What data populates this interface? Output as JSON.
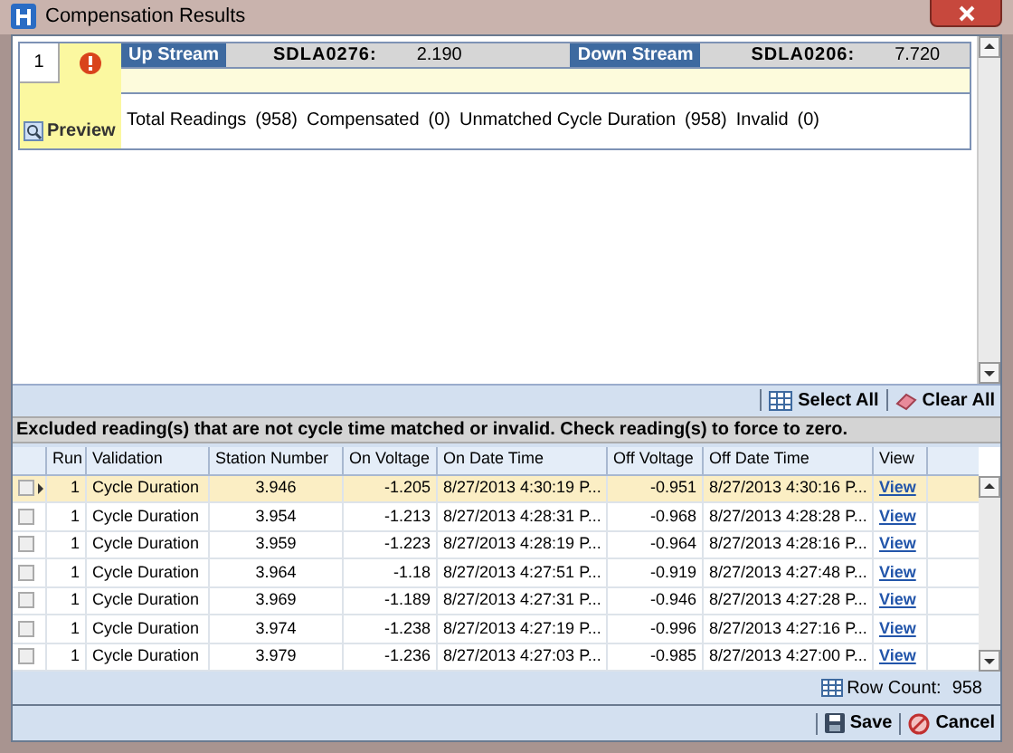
{
  "window": {
    "title": "Compensation Results"
  },
  "result_card": {
    "index": "1",
    "preview_label": "Preview",
    "upstream": {
      "label": "Up Stream",
      "station": "SDLA0276:",
      "value": "2.190"
    },
    "downstream": {
      "label": "Down Stream",
      "station": "SDLA0206:",
      "value": "7.720"
    },
    "summary": [
      {
        "label": "Total Readings",
        "count": "(958)"
      },
      {
        "label": "Compensated",
        "count": "(0)"
      },
      {
        "label": "Unmatched Cycle Duration",
        "count": "(958)"
      },
      {
        "label": "Invalid",
        "count": "(0)"
      }
    ]
  },
  "toolbar": {
    "select_all": "Select All",
    "clear_all": "Clear All"
  },
  "message": "Excluded reading(s) that are not cycle time matched or invalid. Check reading(s) to force to zero.",
  "table": {
    "columns": [
      "Run",
      "Validation",
      "Station Number",
      "On Voltage",
      "On Date Time",
      "Off Voltage",
      "Off Date Time",
      "View"
    ],
    "rows": [
      {
        "selected": true,
        "checked": false,
        "cells": [
          "1",
          "Cycle Duration",
          "3.946",
          "-1.205",
          "8/27/2013 4:30:19 P...",
          "-0.951",
          "8/27/2013 4:30:16 P...",
          "View"
        ]
      },
      {
        "selected": false,
        "checked": false,
        "cells": [
          "1",
          "Cycle Duration",
          "3.954",
          "-1.213",
          "8/27/2013 4:28:31 P...",
          "-0.968",
          "8/27/2013 4:28:28 P...",
          "View"
        ]
      },
      {
        "selected": false,
        "checked": false,
        "cells": [
          "1",
          "Cycle Duration",
          "3.959",
          "-1.223",
          "8/27/2013 4:28:19 P...",
          "-0.964",
          "8/27/2013 4:28:16 P...",
          "View"
        ]
      },
      {
        "selected": false,
        "checked": false,
        "cells": [
          "1",
          "Cycle Duration",
          "3.964",
          "-1.18",
          "8/27/2013 4:27:51 P...",
          "-0.919",
          "8/27/2013 4:27:48 P...",
          "View"
        ]
      },
      {
        "selected": false,
        "checked": false,
        "cells": [
          "1",
          "Cycle Duration",
          "3.969",
          "-1.189",
          "8/27/2013 4:27:31 P...",
          "-0.946",
          "8/27/2013 4:27:28 P...",
          "View"
        ]
      },
      {
        "selected": false,
        "checked": false,
        "cells": [
          "1",
          "Cycle Duration",
          "3.974",
          "-1.238",
          "8/27/2013 4:27:19 P...",
          "-0.996",
          "8/27/2013 4:27:16 P...",
          "View"
        ]
      },
      {
        "selected": false,
        "checked": false,
        "cells": [
          "1",
          "Cycle Duration",
          "3.979",
          "-1.236",
          "8/27/2013 4:27:03 P...",
          "-0.985",
          "8/27/2013 4:27:00 P...",
          "View"
        ]
      }
    ]
  },
  "row_count": {
    "label": "Row Count:",
    "value": "958"
  },
  "buttons": {
    "save": "Save",
    "cancel": "Cancel"
  }
}
